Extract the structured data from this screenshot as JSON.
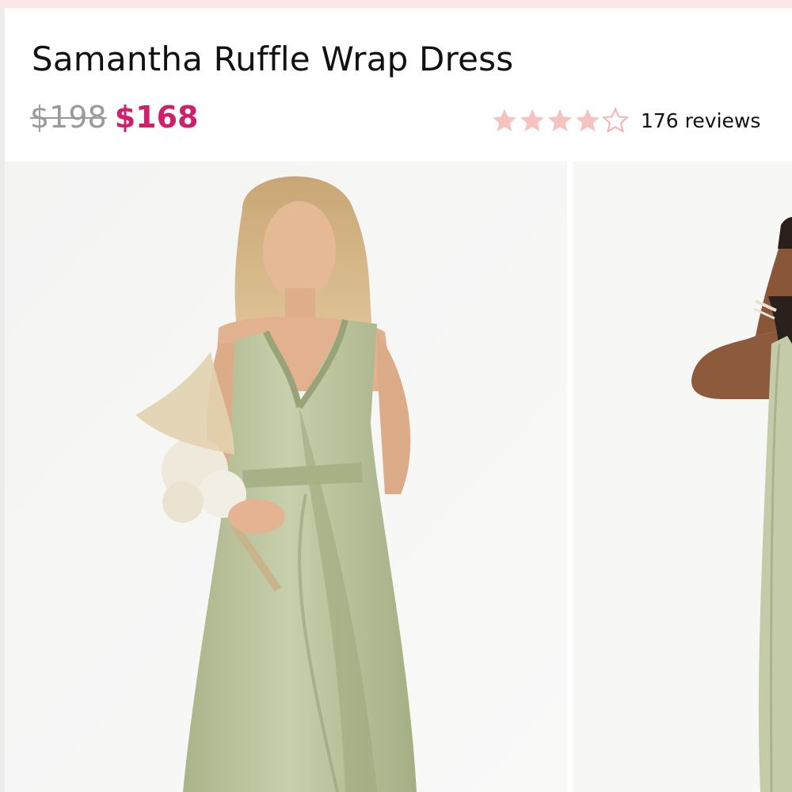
{
  "product": {
    "title": "Samantha Ruffle Wrap Dress",
    "price_original": "$198",
    "price_sale": "$168"
  },
  "rating": {
    "value": 4,
    "max": 5,
    "reviews_text": "176 reviews"
  },
  "colors": {
    "sale_price": "#d0206b",
    "original_price": "#9a9a9a",
    "star_filled": "#f7c3c0",
    "star_outline": "#f2b4b0",
    "dress": "#b8c19a"
  },
  "gallery": {
    "images": [
      {
        "alt": "model-front-view",
        "icon": "product-photo"
      },
      {
        "alt": "model-side-view",
        "icon": "product-photo"
      }
    ]
  }
}
